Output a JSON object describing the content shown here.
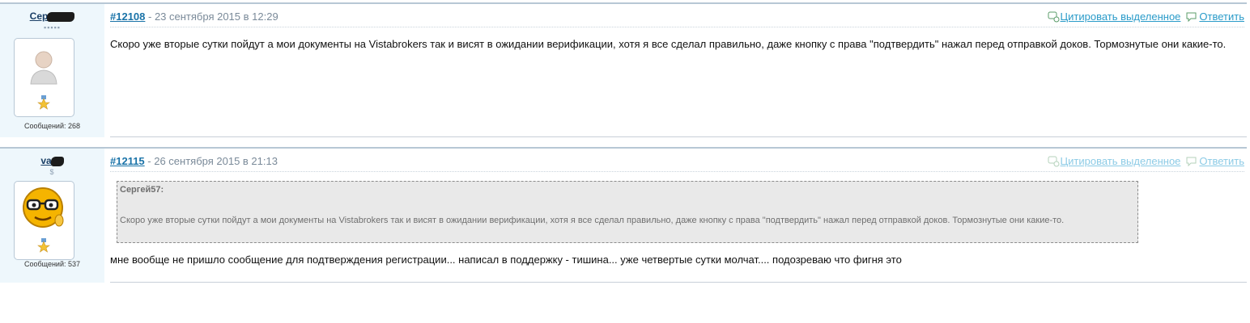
{
  "posts": [
    {
      "author": {
        "name": "Сер",
        "rank_stars": "▪▪▪▪▪",
        "messages": "Сообщений: 268"
      },
      "number": "#12108",
      "date": " - 23 сентября 2015 в 12:29",
      "quote_label": "Цитировать выделенное",
      "reply_label": "Ответить",
      "text": "Скоро уже вторые сутки пойдут а мои документы на Vistabrokers так и висят в ожидании верификации, хотя я все сделал правильно, даже кнопку с права \"подтвердить\" нажал перед отправкой доков. Тормознутые они какие-то."
    },
    {
      "author": {
        "name": "va",
        "rank_stars": "$",
        "messages": "Сообщений: 537"
      },
      "number": "#12115",
      "date": " - 26 сентября 2015 в 21:13",
      "quote_label": "Цитировать выделенное",
      "reply_label": "Ответить",
      "quote": {
        "author": "Сергей57:",
        "text": "Скоро уже вторые сутки пойдут а мои документы на Vistabrokers так и висят в ожидании верификации, хотя я все сделал правильно, даже кнопку с права \"подтвердить\" нажал перед отправкой доков. Тормознутые они какие-то."
      },
      "text": "мне вообще не пришло сообщение для подтверждения регистрации... написал в поддержку - тишина... уже четвертые сутки молчат.... подозреваю что фигня это"
    }
  ],
  "icons": {
    "quote": "quote-selection-icon",
    "reply": "reply-bubble-icon",
    "medal": "medal-icon",
    "default_avatar": "default-user-avatar",
    "smiley_avatar": "smiley-glasses-avatar"
  },
  "colors": {
    "link": "#1a73a8",
    "action": "#2a9bc9",
    "author_bg": "#eef7fc"
  }
}
